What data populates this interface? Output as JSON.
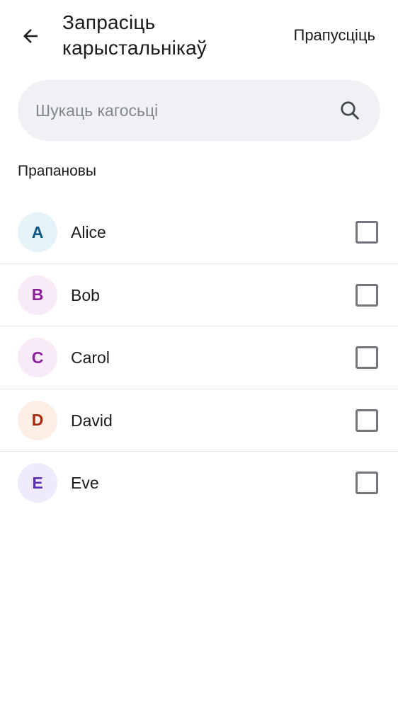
{
  "header": {
    "title": "Запрасіць карыстальнікаў",
    "skip_label": "Прапусціць",
    "back_icon": "arrow-left-icon"
  },
  "search": {
    "placeholder": "Шукаць кагосьці",
    "icon": "search-icon"
  },
  "suggestions": {
    "label": "Прапановы",
    "items": [
      {
        "initial": "A",
        "name": "Alice",
        "checked": false,
        "avatar_bg": "#e3f3f7",
        "avatar_fg": "#0b5a86"
      },
      {
        "initial": "B",
        "name": "Bob",
        "checked": false,
        "avatar_bg": "#f9eaf7",
        "avatar_fg": "#8a1f9a"
      },
      {
        "initial": "C",
        "name": "Carol",
        "checked": false,
        "avatar_bg": "#f9eaf7",
        "avatar_fg": "#8a1f9a"
      },
      {
        "initial": "D",
        "name": "David",
        "checked": false,
        "avatar_bg": "#fdeee5",
        "avatar_fg": "#a4290f"
      },
      {
        "initial": "E",
        "name": "Eve",
        "checked": false,
        "avatar_bg": "#efebfc",
        "avatar_fg": "#5a2fb4"
      }
    ]
  }
}
